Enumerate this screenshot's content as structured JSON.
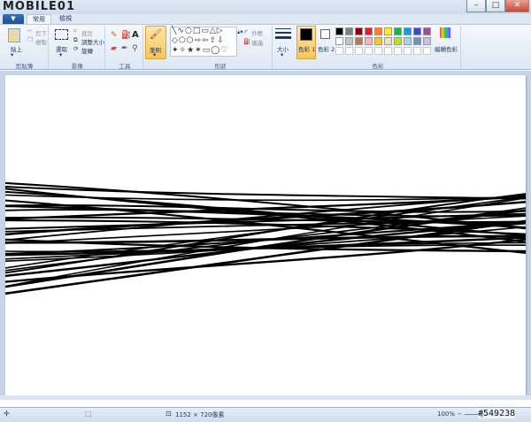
{
  "app": {
    "logo_text": "MOBILE01",
    "tabs": {
      "file": "▼",
      "home": "常用",
      "view": "檢視"
    },
    "window_buttons": {
      "minimize": "–",
      "maximize": "□",
      "close": "✕"
    }
  },
  "ribbon": {
    "clipboard": {
      "label": "剪貼簿",
      "paste": "貼上",
      "cut": "剪下",
      "copy": "複製"
    },
    "image": {
      "label": "影像",
      "select": "選取",
      "crop": "裁剪",
      "resize": "調整大小",
      "rotate": "旋轉"
    },
    "tools": {
      "label": "工具"
    },
    "brushes": {
      "label": "筆刷"
    },
    "shapes": {
      "label": "形狀",
      "outline": "外框",
      "fill": "填滿"
    },
    "size": {
      "label": "大小"
    },
    "colors": {
      "label": "色彩",
      "color1": "色彩 1",
      "color2": "色彩 2",
      "edit": "編輯色彩",
      "palette_row1": [
        "#000000",
        "#7f7f7f",
        "#880015",
        "#ed1c24",
        "#ff7f27",
        "#fff200",
        "#22b14c",
        "#00a2e8",
        "#3f48cc",
        "#a349a4"
      ],
      "palette_row2": [
        "#ffffff",
        "#c3c3c3",
        "#b97a57",
        "#ffaec9",
        "#ffc90e",
        "#efe4b0",
        "#b5e61d",
        "#99d9ea",
        "#7092be",
        "#c8bfe7"
      ]
    }
  },
  "status": {
    "dimensions": "1152 × 720像素",
    "zoom": "100%",
    "zoom_minus": "–",
    "zoom_plus": "+"
  },
  "watermark": "#549238"
}
